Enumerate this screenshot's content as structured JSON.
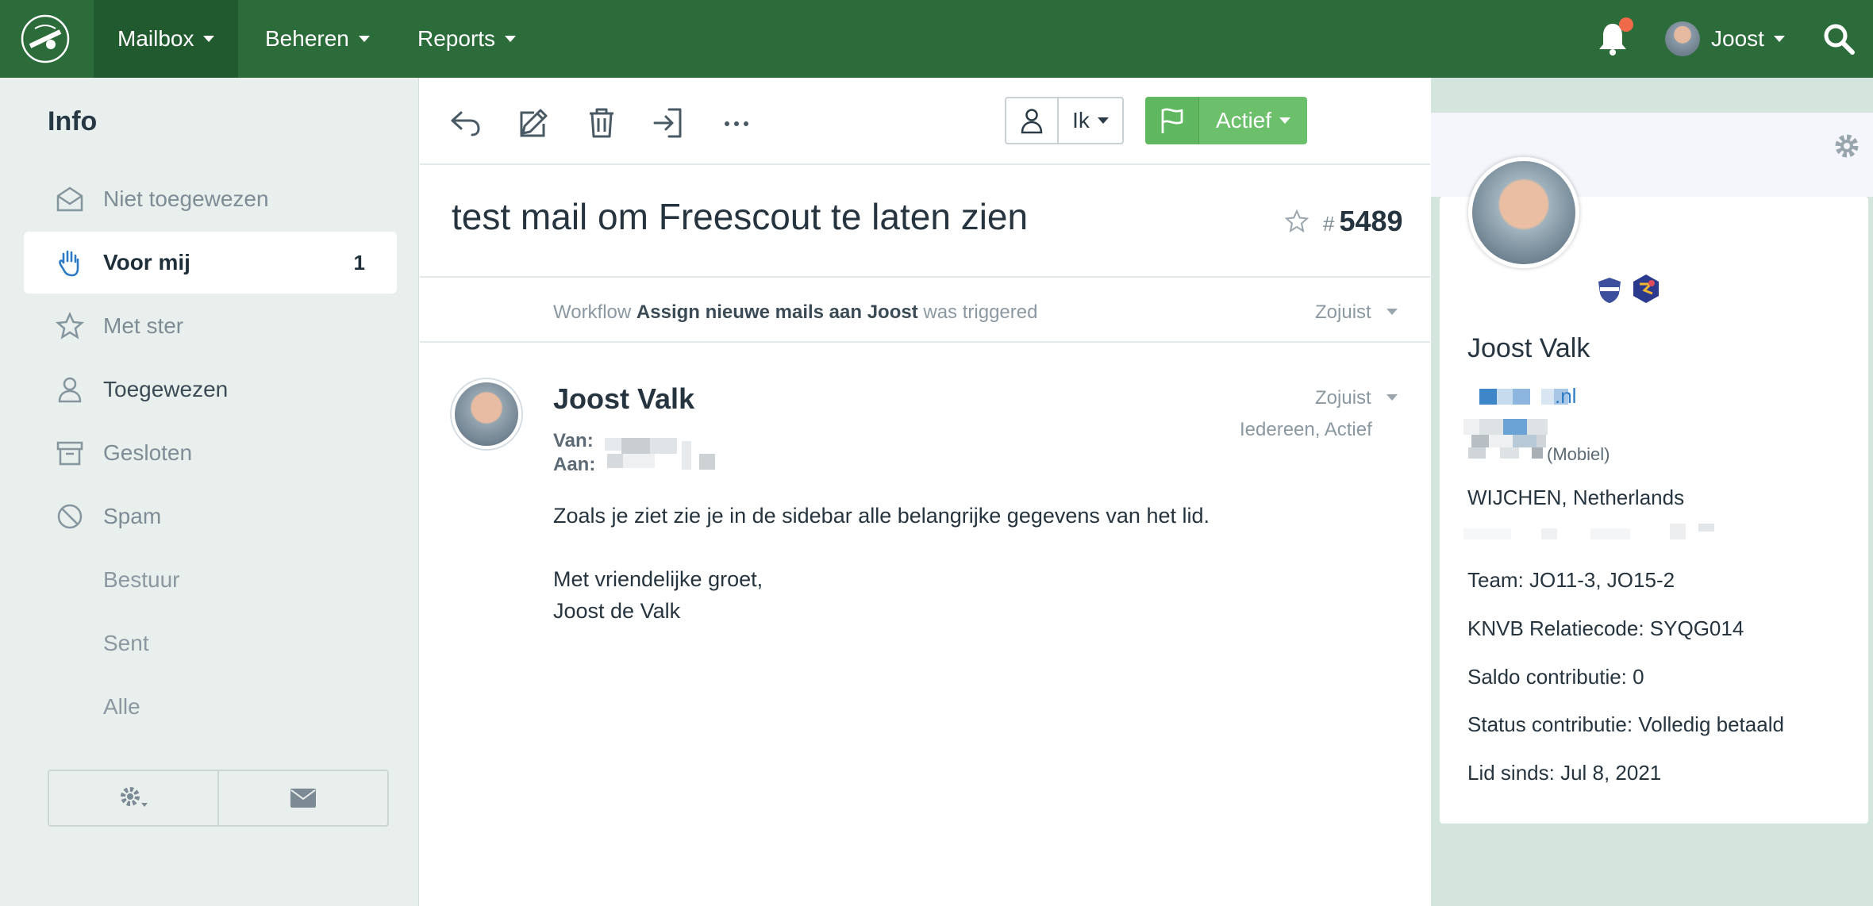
{
  "nav": {
    "items": [
      {
        "label": "Mailbox"
      },
      {
        "label": "Beheren"
      },
      {
        "label": "Reports"
      }
    ],
    "user_label": "Joost"
  },
  "sidebar": {
    "title": "Info",
    "items": [
      {
        "label": "Niet toegewezen"
      },
      {
        "label": "Voor mij",
        "count": "1"
      },
      {
        "label": "Met ster"
      },
      {
        "label": "Toegewezen"
      },
      {
        "label": "Gesloten"
      },
      {
        "label": "Spam"
      },
      {
        "label": "Bestuur"
      },
      {
        "label": "Sent"
      },
      {
        "label": "Alle"
      }
    ]
  },
  "toolbar": {
    "assignee_label": "Ik",
    "status_label": "Actief"
  },
  "conversation": {
    "subject": "test mail om Freescout te laten zien",
    "number_hash": "#",
    "number": "5489",
    "workflow": {
      "prefix": "Workflow",
      "name": "Assign nieuwe mails aan Joost",
      "suffix": "was triggered",
      "time": "Zojuist"
    },
    "message": {
      "from_name": "Joost Valk",
      "time": "Zojuist",
      "meta": "Iedereen, Actief",
      "van_label": "Van:",
      "aan_label": "Aan:",
      "body_line1": "Zoals je ziet zie je in de sidebar alle belangrijke gegevens van het lid.",
      "body_line2": "Met vriendelijke groet,",
      "body_line3": "Joost de Valk"
    }
  },
  "customer": {
    "name": "Joost Valk",
    "email_suffix": ".nl",
    "phone_type": "(Mobiel)",
    "location": "WIJCHEN, Netherlands",
    "team": "Team: JO11-3, JO15-2",
    "relatiecode": "KNVB Relatiecode: SYQG014",
    "saldo": "Saldo contributie: 0",
    "status": "Status contributie: Volledig betaald",
    "lid_sinds": "Lid sinds: Jul 8, 2021"
  },
  "colors": {
    "nav_bg": "#2c6b3a",
    "status_green": "#6cc06c",
    "link_blue": "#2c7bc4",
    "sidebar_bg": "#e9efec",
    "right_panel_bg": "#d4e5dd"
  }
}
